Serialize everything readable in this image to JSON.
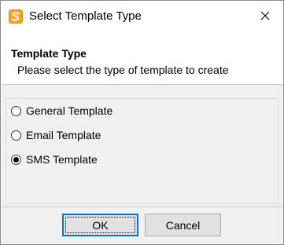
{
  "window": {
    "title": "Select Template Type",
    "app_icon": "app-logo-icon",
    "close_icon": "close-icon"
  },
  "header": {
    "title": "Template Type",
    "subtitle": "Please select the type of template to create"
  },
  "options": [
    {
      "label": "General Template",
      "selected": false
    },
    {
      "label": "Email Template",
      "selected": false
    },
    {
      "label": "SMS Template",
      "selected": true
    }
  ],
  "buttons": {
    "ok_label": "OK",
    "cancel_label": "Cancel"
  },
  "colors": {
    "panel_bg": "#f0f0f0",
    "default_button_border": "#0078d7",
    "app_icon_orange": "#f5a623"
  }
}
